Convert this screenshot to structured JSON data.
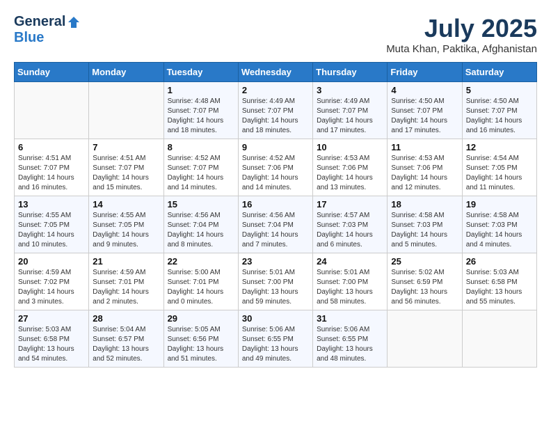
{
  "header": {
    "logo_general": "General",
    "logo_blue": "Blue",
    "month_year": "July 2025",
    "location": "Muta Khan, Paktika, Afghanistan"
  },
  "weekdays": [
    "Sunday",
    "Monday",
    "Tuesday",
    "Wednesday",
    "Thursday",
    "Friday",
    "Saturday"
  ],
  "weeks": [
    [
      {
        "day": "",
        "sunrise": "",
        "sunset": "",
        "daylight": ""
      },
      {
        "day": "",
        "sunrise": "",
        "sunset": "",
        "daylight": ""
      },
      {
        "day": "1",
        "sunrise": "Sunrise: 4:48 AM",
        "sunset": "Sunset: 7:07 PM",
        "daylight": "Daylight: 14 hours and 18 minutes."
      },
      {
        "day": "2",
        "sunrise": "Sunrise: 4:49 AM",
        "sunset": "Sunset: 7:07 PM",
        "daylight": "Daylight: 14 hours and 18 minutes."
      },
      {
        "day": "3",
        "sunrise": "Sunrise: 4:49 AM",
        "sunset": "Sunset: 7:07 PM",
        "daylight": "Daylight: 14 hours and 17 minutes."
      },
      {
        "day": "4",
        "sunrise": "Sunrise: 4:50 AM",
        "sunset": "Sunset: 7:07 PM",
        "daylight": "Daylight: 14 hours and 17 minutes."
      },
      {
        "day": "5",
        "sunrise": "Sunrise: 4:50 AM",
        "sunset": "Sunset: 7:07 PM",
        "daylight": "Daylight: 14 hours and 16 minutes."
      }
    ],
    [
      {
        "day": "6",
        "sunrise": "Sunrise: 4:51 AM",
        "sunset": "Sunset: 7:07 PM",
        "daylight": "Daylight: 14 hours and 16 minutes."
      },
      {
        "day": "7",
        "sunrise": "Sunrise: 4:51 AM",
        "sunset": "Sunset: 7:07 PM",
        "daylight": "Daylight: 14 hours and 15 minutes."
      },
      {
        "day": "8",
        "sunrise": "Sunrise: 4:52 AM",
        "sunset": "Sunset: 7:07 PM",
        "daylight": "Daylight: 14 hours and 14 minutes."
      },
      {
        "day": "9",
        "sunrise": "Sunrise: 4:52 AM",
        "sunset": "Sunset: 7:06 PM",
        "daylight": "Daylight: 14 hours and 14 minutes."
      },
      {
        "day": "10",
        "sunrise": "Sunrise: 4:53 AM",
        "sunset": "Sunset: 7:06 PM",
        "daylight": "Daylight: 14 hours and 13 minutes."
      },
      {
        "day": "11",
        "sunrise": "Sunrise: 4:53 AM",
        "sunset": "Sunset: 7:06 PM",
        "daylight": "Daylight: 14 hours and 12 minutes."
      },
      {
        "day": "12",
        "sunrise": "Sunrise: 4:54 AM",
        "sunset": "Sunset: 7:05 PM",
        "daylight": "Daylight: 14 hours and 11 minutes."
      }
    ],
    [
      {
        "day": "13",
        "sunrise": "Sunrise: 4:55 AM",
        "sunset": "Sunset: 7:05 PM",
        "daylight": "Daylight: 14 hours and 10 minutes."
      },
      {
        "day": "14",
        "sunrise": "Sunrise: 4:55 AM",
        "sunset": "Sunset: 7:05 PM",
        "daylight": "Daylight: 14 hours and 9 minutes."
      },
      {
        "day": "15",
        "sunrise": "Sunrise: 4:56 AM",
        "sunset": "Sunset: 7:04 PM",
        "daylight": "Daylight: 14 hours and 8 minutes."
      },
      {
        "day": "16",
        "sunrise": "Sunrise: 4:56 AM",
        "sunset": "Sunset: 7:04 PM",
        "daylight": "Daylight: 14 hours and 7 minutes."
      },
      {
        "day": "17",
        "sunrise": "Sunrise: 4:57 AM",
        "sunset": "Sunset: 7:03 PM",
        "daylight": "Daylight: 14 hours and 6 minutes."
      },
      {
        "day": "18",
        "sunrise": "Sunrise: 4:58 AM",
        "sunset": "Sunset: 7:03 PM",
        "daylight": "Daylight: 14 hours and 5 minutes."
      },
      {
        "day": "19",
        "sunrise": "Sunrise: 4:58 AM",
        "sunset": "Sunset: 7:03 PM",
        "daylight": "Daylight: 14 hours and 4 minutes."
      }
    ],
    [
      {
        "day": "20",
        "sunrise": "Sunrise: 4:59 AM",
        "sunset": "Sunset: 7:02 PM",
        "daylight": "Daylight: 14 hours and 3 minutes."
      },
      {
        "day": "21",
        "sunrise": "Sunrise: 4:59 AM",
        "sunset": "Sunset: 7:01 PM",
        "daylight": "Daylight: 14 hours and 2 minutes."
      },
      {
        "day": "22",
        "sunrise": "Sunrise: 5:00 AM",
        "sunset": "Sunset: 7:01 PM",
        "daylight": "Daylight: 14 hours and 0 minutes."
      },
      {
        "day": "23",
        "sunrise": "Sunrise: 5:01 AM",
        "sunset": "Sunset: 7:00 PM",
        "daylight": "Daylight: 13 hours and 59 minutes."
      },
      {
        "day": "24",
        "sunrise": "Sunrise: 5:01 AM",
        "sunset": "Sunset: 7:00 PM",
        "daylight": "Daylight: 13 hours and 58 minutes."
      },
      {
        "day": "25",
        "sunrise": "Sunrise: 5:02 AM",
        "sunset": "Sunset: 6:59 PM",
        "daylight": "Daylight: 13 hours and 56 minutes."
      },
      {
        "day": "26",
        "sunrise": "Sunrise: 5:03 AM",
        "sunset": "Sunset: 6:58 PM",
        "daylight": "Daylight: 13 hours and 55 minutes."
      }
    ],
    [
      {
        "day": "27",
        "sunrise": "Sunrise: 5:03 AM",
        "sunset": "Sunset: 6:58 PM",
        "daylight": "Daylight: 13 hours and 54 minutes."
      },
      {
        "day": "28",
        "sunrise": "Sunrise: 5:04 AM",
        "sunset": "Sunset: 6:57 PM",
        "daylight": "Daylight: 13 hours and 52 minutes."
      },
      {
        "day": "29",
        "sunrise": "Sunrise: 5:05 AM",
        "sunset": "Sunset: 6:56 PM",
        "daylight": "Daylight: 13 hours and 51 minutes."
      },
      {
        "day": "30",
        "sunrise": "Sunrise: 5:06 AM",
        "sunset": "Sunset: 6:55 PM",
        "daylight": "Daylight: 13 hours and 49 minutes."
      },
      {
        "day": "31",
        "sunrise": "Sunrise: 5:06 AM",
        "sunset": "Sunset: 6:55 PM",
        "daylight": "Daylight: 13 hours and 48 minutes."
      },
      {
        "day": "",
        "sunrise": "",
        "sunset": "",
        "daylight": ""
      },
      {
        "day": "",
        "sunrise": "",
        "sunset": "",
        "daylight": ""
      }
    ]
  ]
}
